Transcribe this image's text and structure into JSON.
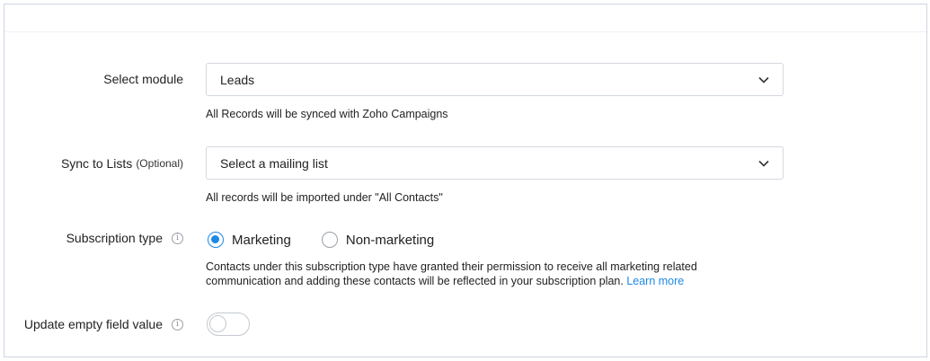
{
  "module": {
    "label": "Select module",
    "selected": "Leads",
    "hint": "All Records will be synced with Zoho Campaigns"
  },
  "lists": {
    "label": "Sync to Lists",
    "optional": "(Optional)",
    "selected": "Select a mailing list",
    "hint": "All records will be imported under \"All Contacts\""
  },
  "subscription": {
    "label": "Subscription type",
    "options": [
      {
        "label": "Marketing",
        "checked": true
      },
      {
        "label": "Non-marketing",
        "checked": false
      }
    ],
    "hint_line1": "Contacts under this subscription type have granted their permission to receive all marketing related",
    "hint_line2": "communication and adding these contacts will be reflected in your subscription plan.",
    "learn_more": "Learn more"
  },
  "update_empty": {
    "label": "Update empty field value",
    "enabled": false
  },
  "colors": {
    "accent": "#1e88e5",
    "border": "#d3d8df"
  }
}
